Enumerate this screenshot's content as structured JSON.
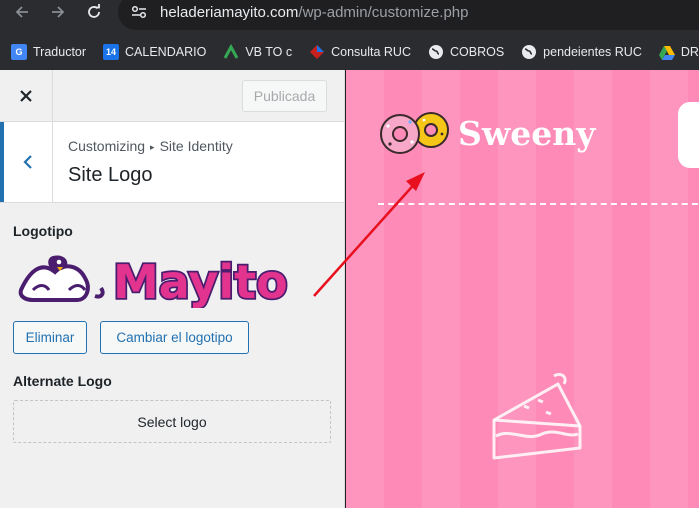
{
  "browser": {
    "url_host": "heladeriamayito.com",
    "url_path": "/wp-admin/customize.php",
    "bookmarks": [
      {
        "label": "Traductor",
        "icon": "translate-icon",
        "color": "#4285f4",
        "glyph": "G"
      },
      {
        "label": "CALENDARIO",
        "icon": "calendar-icon",
        "color": "#1a73e8",
        "glyph": "14"
      },
      {
        "label": "VB TO c",
        "icon": "vbto-icon",
        "color": "#34a853",
        "glyph": "V"
      },
      {
        "label": "Consulta RUC",
        "icon": "sunat-icon",
        "color": "#c5221f",
        "glyph": "◆"
      },
      {
        "label": "COBROS",
        "icon": "globe-icon",
        "color": "#e8eaed",
        "glyph": "🌐"
      },
      {
        "label": "pendeientes RUC",
        "icon": "globe-icon",
        "color": "#e8eaed",
        "glyph": "🌐"
      },
      {
        "label": "DRIVE",
        "icon": "drive-icon",
        "color": "#fbbc04",
        "glyph": "▲"
      }
    ]
  },
  "customizer": {
    "publish_label": "Publicada",
    "breadcrumb_root": "Customizing",
    "breadcrumb_section": "Site Identity",
    "section_title": "Site Logo",
    "logo_label": "Logotipo",
    "logo_image_text": "Mayito",
    "remove_label": "Eliminar",
    "change_label": "Cambiar el logotipo",
    "alt_logo_label": "Alternate Logo",
    "select_logo_label": "Select logo"
  },
  "preview": {
    "site_name": "Sweeny",
    "background_color": "#fd8ab7"
  },
  "colors": {
    "accent": "#2271b1",
    "annotation_arrow": "#e8101e",
    "logo_purple": "#4a1d6e",
    "logo_pink": "#e2348f"
  }
}
